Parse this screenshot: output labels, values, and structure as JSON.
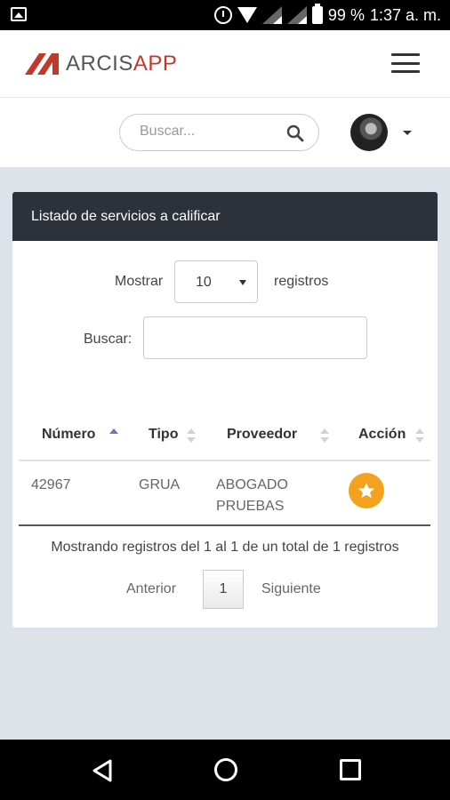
{
  "status_bar": {
    "battery": "99 %",
    "time": "1:37 a. m.",
    "icons": [
      "gallery-icon",
      "alarm-icon",
      "wifi-icon",
      "signal-icon",
      "signal-icon",
      "battery-icon"
    ]
  },
  "header": {
    "logo_text_1": "ARCIS",
    "logo_text_2": "APP",
    "brand_colors": {
      "mark": "#c0392b",
      "text": "#555555",
      "accent": "#c0392b"
    }
  },
  "search": {
    "placeholder": "Buscar...",
    "value": ""
  },
  "card": {
    "title": "Listado de servicios a calificar",
    "show_label": "Mostrar",
    "page_size": "10",
    "records_label": "registros",
    "filter_label": "Buscar:",
    "filter_value": "",
    "columns": [
      "Número",
      "Tipo",
      "Proveedor",
      "Acción"
    ],
    "rows": [
      {
        "numero": "42967",
        "tipo": "GRUA",
        "proveedor_1": "ABOGADO",
        "proveedor_2": "PRUEBAS"
      }
    ],
    "info": "Mostrando registros del 1 al 1 de un total de 1 registros",
    "pagination": {
      "prev": "Anterior",
      "page": "1",
      "next": "Siguiente"
    },
    "action_color": "#f3a21d",
    "header_color": "#2d323a"
  }
}
